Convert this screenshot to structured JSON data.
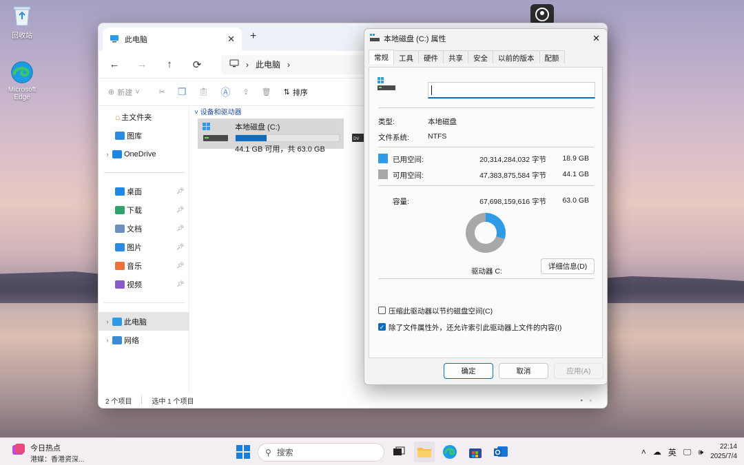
{
  "desktop": {
    "icons": [
      {
        "label": "回收站",
        "icon": "recycle-bin-icon"
      },
      {
        "label": "Microsoft Edge",
        "icon": "edge-icon"
      }
    ]
  },
  "explorer": {
    "tab_title": "此电脑",
    "tab_close": "✕",
    "new_tab": "+",
    "address": "此电脑",
    "nav": {
      "back": "←",
      "forward": "→",
      "up": "↑",
      "refresh": "⟳",
      "sep": "›"
    },
    "toolbar": {
      "new_label": "新建",
      "sort_label": "排序"
    },
    "sidebar": {
      "top": [
        {
          "label": "主文件夹",
          "icon": "home-icon"
        },
        {
          "label": "图库",
          "icon": "gallery-icon"
        },
        {
          "label": "OneDrive",
          "icon": "onedrive-icon"
        }
      ],
      "quick": [
        {
          "label": "桌面",
          "icon": "desktop-folder-icon",
          "color": "#1e88e5"
        },
        {
          "label": "下载",
          "icon": "downloads-folder-icon",
          "color": "#2fa36b"
        },
        {
          "label": "文档",
          "icon": "documents-folder-icon",
          "color": "#6c8fbf"
        },
        {
          "label": "图片",
          "icon": "pictures-folder-icon",
          "color": "#2b8be0"
        },
        {
          "label": "音乐",
          "icon": "music-folder-icon",
          "color": "#e8743b"
        },
        {
          "label": "视频",
          "icon": "videos-folder-icon",
          "color": "#8a5cc9"
        }
      ],
      "bottom": [
        {
          "label": "此电脑",
          "icon": "this-pc-icon"
        },
        {
          "label": "网络",
          "icon": "network-icon"
        }
      ]
    },
    "group_label": "设备和驱动器",
    "drive": {
      "name": "本地磁盘 (C:)",
      "free_text": "44.1 GB 可用，共 63.0 GB",
      "used_fraction": 0.3
    },
    "status": {
      "count": "2 个项目",
      "selected": "选中 1 个项目"
    }
  },
  "dialog": {
    "title": "本地磁盘 (C:) 属性",
    "tabs": [
      "常规",
      "工具",
      "硬件",
      "共享",
      "安全",
      "以前的版本",
      "配额"
    ],
    "active_tab": "常规",
    "name_value": "",
    "type_label": "类型:",
    "type_value": "本地磁盘",
    "fs_label": "文件系统:",
    "fs_value": "NTFS",
    "used_label": "已用空间:",
    "used_bytes": "20,314,284,032 字节",
    "used_gb": "18.9 GB",
    "free_label": "可用空间:",
    "free_bytes": "47,383,875,584 字节",
    "free_gb": "44.1 GB",
    "cap_label": "容量:",
    "cap_bytes": "67,698,159,616 字节",
    "cap_gb": "63.0 GB",
    "drive_label": "驱动器 C:",
    "details_button": "详细信息(D)",
    "compress_label": "压缩此驱动器以节约磁盘空间(C)",
    "compress_checked": false,
    "index_label": "除了文件属性外，还允许索引此驱动器上文件的内容(I)",
    "index_checked": true,
    "ok": "确定",
    "cancel": "取消",
    "apply": "应用(A)",
    "used_color": "#2e9be6",
    "free_color": "#a8a8a8",
    "used_percent": 30
  },
  "taskbar": {
    "news_title": "今日热点",
    "news_sub": "港媒：香港资深...",
    "search_placeholder": "搜索",
    "ime": "英",
    "time": "22:14",
    "date": "2025/7/4"
  }
}
